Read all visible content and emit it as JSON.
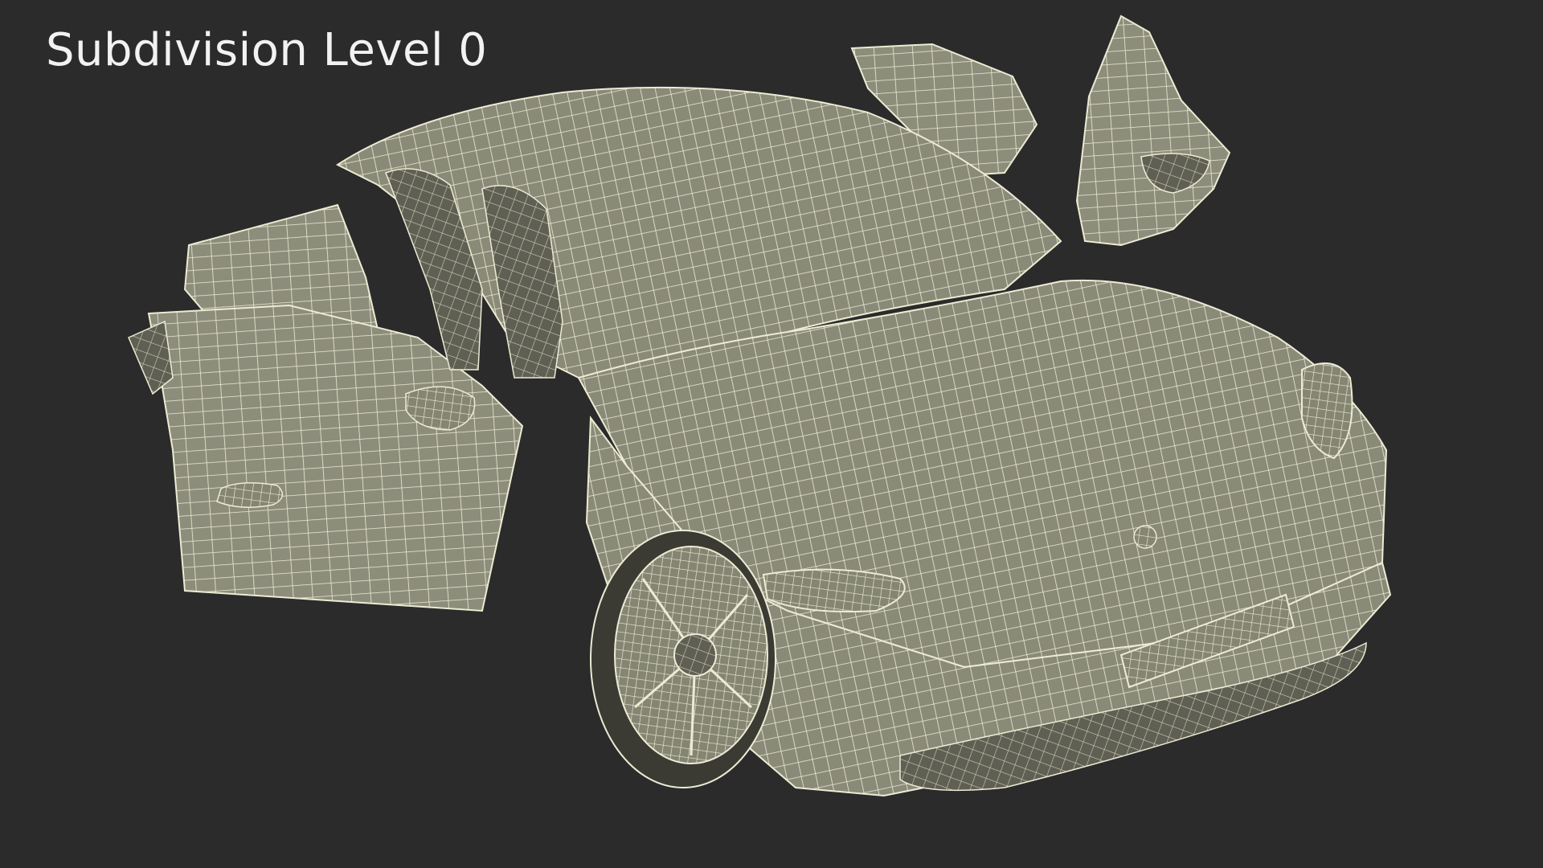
{
  "caption": "Subdivision Level 0",
  "colors": {
    "background": "#2b2b2b",
    "surface": "#8a8a78",
    "surface_shadow": "#6e6e60",
    "surface_light": "#9a9a88",
    "wire": "#ecebd4",
    "caption_text": "#f2f2f2"
  }
}
